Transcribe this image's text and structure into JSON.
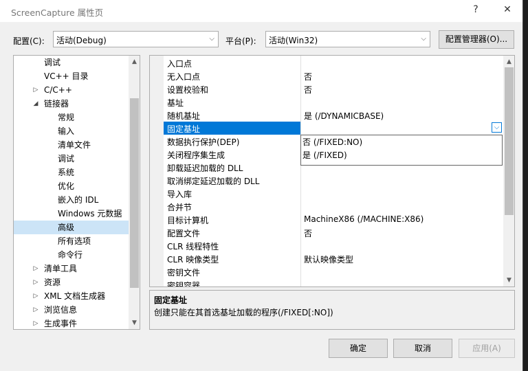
{
  "window": {
    "title": "ScreenCapture 属性页",
    "help_glyph": "?",
    "close_glyph": "✕"
  },
  "toolbar": {
    "config_label": "配置(C):",
    "config_value": "活动(Debug)",
    "platform_label": "平台(P):",
    "platform_value": "活动(Win32)",
    "config_manager_label": "配置管理器(O)..."
  },
  "tree": {
    "items": [
      {
        "label": "调试",
        "expander": ""
      },
      {
        "label": "VC++ 目录",
        "expander": ""
      },
      {
        "label": "C/C++",
        "expander": "▷"
      },
      {
        "label": "链接器",
        "expander": "◢"
      },
      {
        "label": "常规",
        "expander": ""
      },
      {
        "label": "输入",
        "expander": ""
      },
      {
        "label": "清单文件",
        "expander": ""
      },
      {
        "label": "调试",
        "expander": ""
      },
      {
        "label": "系统",
        "expander": ""
      },
      {
        "label": "优化",
        "expander": ""
      },
      {
        "label": "嵌入的 IDL",
        "expander": ""
      },
      {
        "label": "Windows 元数据",
        "expander": ""
      },
      {
        "label": "高级",
        "expander": "",
        "selected": true
      },
      {
        "label": "所有选项",
        "expander": ""
      },
      {
        "label": "命令行",
        "expander": ""
      },
      {
        "label": "清单工具",
        "expander": "▷"
      },
      {
        "label": "资源",
        "expander": "▷"
      },
      {
        "label": "XML 文档生成器",
        "expander": "▷"
      },
      {
        "label": "浏览信息",
        "expander": "▷"
      },
      {
        "label": "生成事件",
        "expander": "▷"
      }
    ]
  },
  "properties": [
    {
      "name": "入口点",
      "value": ""
    },
    {
      "name": "无入口点",
      "value": "否"
    },
    {
      "name": "设置校验和",
      "value": "否"
    },
    {
      "name": "基址",
      "value": ""
    },
    {
      "name": "随机基址",
      "value": "是 (/DYNAMICBASE)"
    },
    {
      "name": "固定基址",
      "value": "",
      "selected": true
    },
    {
      "name": "数据执行保护(DEP)",
      "value": ""
    },
    {
      "name": "关闭程序集生成",
      "value": ""
    },
    {
      "name": "卸载延迟加载的 DLL",
      "value": ""
    },
    {
      "name": "取消绑定延迟加载的 DLL",
      "value": ""
    },
    {
      "name": "导入库",
      "value": ""
    },
    {
      "name": "合并节",
      "value": ""
    },
    {
      "name": "目标计算机",
      "value": "MachineX86 (/MACHINE:X86)"
    },
    {
      "name": "配置文件",
      "value": "否"
    },
    {
      "name": "CLR 线程特性",
      "value": ""
    },
    {
      "name": "CLR 映像类型",
      "value": "默认映像类型"
    },
    {
      "name": "密钥文件",
      "value": ""
    },
    {
      "name": "密钥容器",
      "value": ""
    }
  ],
  "dropdown": {
    "options": [
      "否 (/FIXED:NO)",
      "是 (/FIXED)"
    ]
  },
  "description": {
    "title": "固定基址",
    "text": "创建只能在其首选基址加载的程序(/FIXED[:NO])"
  },
  "buttons": {
    "ok": "确定",
    "cancel": "取消",
    "apply": "应用(A)"
  },
  "colors": {
    "selection": "#0078d7",
    "tree_selection": "#cce4f7",
    "disabled_text": "#a0a0a0"
  }
}
